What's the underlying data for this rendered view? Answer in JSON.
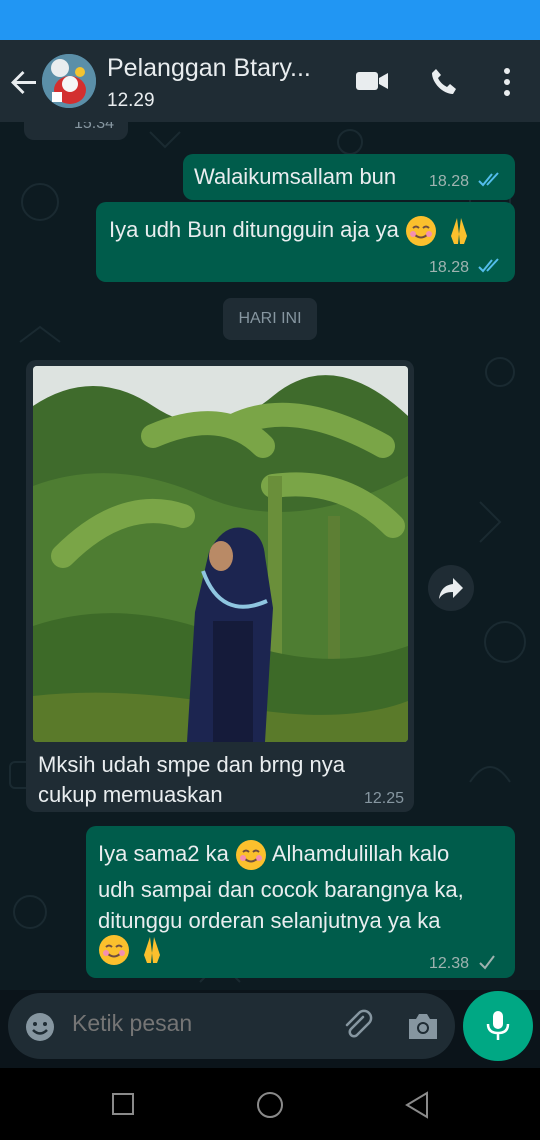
{
  "header": {
    "contact_name": "Pelanggan Btary...",
    "last_seen": "12.29",
    "icons": [
      "back-arrow-icon",
      "video-call-icon",
      "phone-call-icon",
      "more-options-icon"
    ]
  },
  "messages": {
    "partial_time": "15.34",
    "m1": {
      "text": "Walaikumsallam bun",
      "time": "18.28",
      "status": "read"
    },
    "m2": {
      "text": "Iya udh Bun ditungguin aja ya",
      "time": "18.28",
      "status": "read"
    },
    "day_divider": "HARI INI",
    "m3": {
      "line1": "Mksih udah smpe dan brng nya",
      "line2": "cukup memuaskan",
      "time": "12.25"
    },
    "m4": {
      "line1a": "Iya sama2 ka",
      "line1b": "Alhamdulillah kalo",
      "line2": "udh sampai dan cocok barangnya ka,",
      "line3": "ditunggu orderan selanjutnya ya ka",
      "time": "12.38",
      "status": "sent"
    }
  },
  "composer": {
    "placeholder": "Ketik pesan"
  },
  "colors": {
    "outgoing_bubble": "#005c4b",
    "incoming_bubble": "#1f2c34",
    "header": "#1f2c34",
    "status_bar": "#2196f3",
    "read_ticks": "#53bdeb",
    "mic_button": "#00a884"
  }
}
